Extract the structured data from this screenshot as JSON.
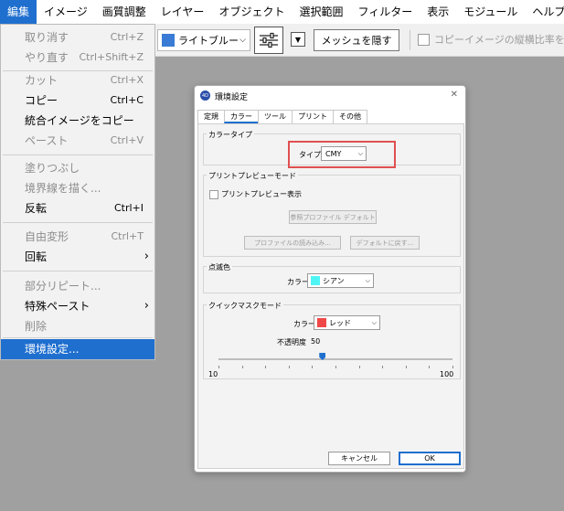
{
  "menubar": {
    "items": [
      "編集",
      "イメージ",
      "画質調整",
      "レイヤー",
      "オブジェクト",
      "選択範囲",
      "フィルター",
      "表示",
      "モジュール",
      "ヘルプ"
    ],
    "active_index": 0
  },
  "toolbar": {
    "color_label": "ライトブルー",
    "color_swatch": "#3a7bd5",
    "hide_mesh_label": "メッシュを隠す",
    "aspect_label": "コピーイメージの縦横比率を保"
  },
  "edit_menu": {
    "items": [
      {
        "label": "取り消す",
        "shortcut": "Ctrl+Z",
        "disabled": true
      },
      {
        "label": "やり直す",
        "shortcut": "Ctrl+Shift+Z",
        "disabled": true
      },
      {
        "label": "カット",
        "shortcut": "Ctrl+X",
        "disabled": true
      },
      {
        "label": "コピー",
        "shortcut": "Ctrl+C",
        "disabled": false
      },
      {
        "label": "統合イメージをコピー",
        "shortcut": "",
        "disabled": false
      },
      {
        "label": "ペースト",
        "shortcut": "Ctrl+V",
        "disabled": true
      },
      {
        "label": "塗りつぶし",
        "shortcut": "",
        "disabled": true
      },
      {
        "label": "境界線を描く...",
        "shortcut": "",
        "disabled": true
      },
      {
        "label": "反転",
        "shortcut": "Ctrl+I",
        "disabled": false
      },
      {
        "label": "自由変形",
        "shortcut": "Ctrl+T",
        "disabled": true
      },
      {
        "label": "回転",
        "shortcut": "",
        "disabled": false
      },
      {
        "label": "部分リピート...",
        "shortcut": "",
        "disabled": true
      },
      {
        "label": "特殊ペースト",
        "shortcut": "",
        "disabled": false
      },
      {
        "label": "削除",
        "shortcut": "",
        "disabled": true
      },
      {
        "label": "環境設定...",
        "shortcut": "",
        "disabled": false
      }
    ]
  },
  "dialog": {
    "title": "環境設定",
    "icon_text": "4D",
    "tabs": [
      "定規",
      "カラー",
      "ツール",
      "プリント",
      "その他"
    ],
    "active_tab": 1,
    "color_type": {
      "group_label": "カラータイプ",
      "type_label": "タイプ",
      "type_value": "CMY"
    },
    "print_preview": {
      "group_label": "プリントプレビューモード",
      "checkbox_label": "プリントプレビュー表示",
      "ref_profile_btn": "参照プロファイル デフォルト",
      "load_profile_btn": "プロファイルの読み込み...",
      "reset_default_btn": "デフォルトに戻す..."
    },
    "blink_color": {
      "group_label": "点滅色",
      "color_label": "カラー",
      "value": "シアン",
      "swatch": "#4ef5f5"
    },
    "quick_mask": {
      "group_label": "クイックマスクモード",
      "color_label": "カラー",
      "value": "レッド",
      "swatch": "#f04848",
      "opacity_label": "不透明度",
      "opacity_value": "50",
      "opacity_number": 50,
      "min_label": "10",
      "max_label": "100",
      "min": 10,
      "max": 100
    },
    "cancel_label": "キャンセル",
    "ok_label": "OK"
  }
}
